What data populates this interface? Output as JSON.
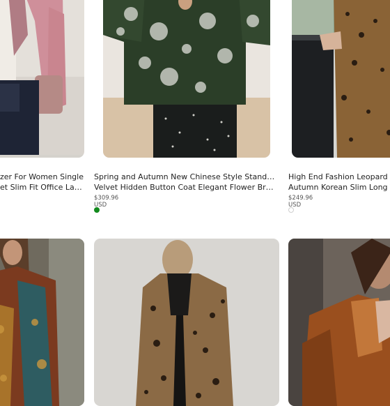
{
  "products": [
    {
      "title_line1": "zer For Women Single",
      "title_line2": "et Slim Fit Office Lady...",
      "price": "",
      "swatch": ""
    },
    {
      "title_line1": "Spring and Autumn New Chinese Style Stand Collar",
      "title_line2": "Velvet Hidden Button Coat Elegant Flower Branch...",
      "price": "$309.96 USD",
      "swatch": "green"
    },
    {
      "title_line1": "High End Fashion Leopard Co",
      "title_line2": "Autumn Korean Slim Long Tre",
      "price": "$249.96 USD",
      "swatch": "white"
    }
  ],
  "colors": {
    "swatch_green": "#138a1e",
    "swatch_white": "#ffffff"
  },
  "images": [
    {
      "icon": "pink-velvet-blazer-photo"
    },
    {
      "icon": "green-sequin-velvet-coat-photo"
    },
    {
      "icon": "leopard-long-coat-photo"
    },
    {
      "icon": "bohemian-velvet-jacket-photo"
    },
    {
      "icon": "leopard-leather-trench-photo"
    },
    {
      "icon": "brown-leather-jacket-photo"
    }
  ]
}
